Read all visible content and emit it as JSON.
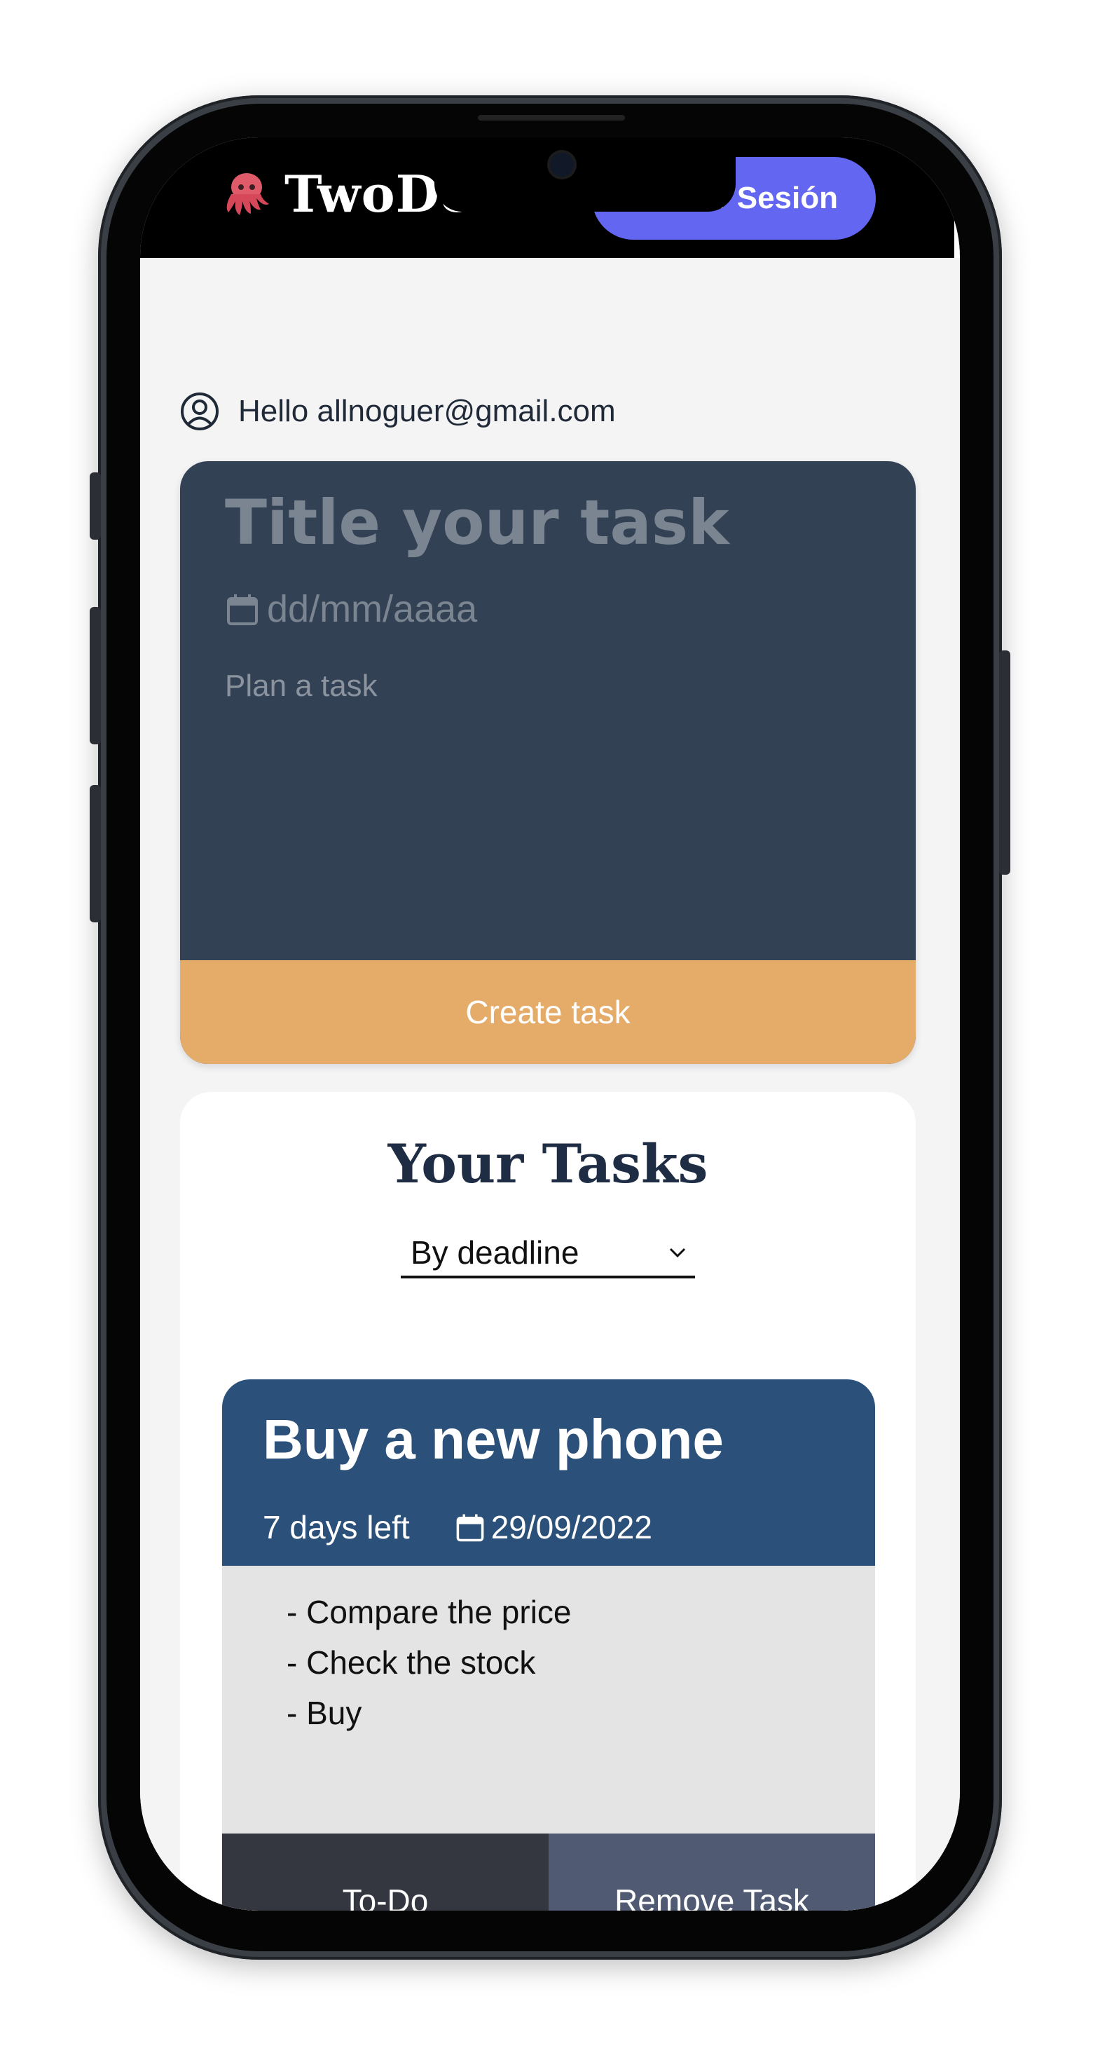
{
  "header": {
    "logo_text": "TwoDo",
    "logout_label": "ar Sesión"
  },
  "user": {
    "greeting": "Hello allnoguer@gmail.com"
  },
  "new_task": {
    "title_placeholder": "Title your task",
    "date_placeholder": "dd/mm/aaaa",
    "description_placeholder": "Plan a task",
    "create_label": "Create task"
  },
  "tasks": {
    "heading": "Your Tasks",
    "sort_value": "By deadline",
    "items": [
      {
        "title": "Buy a new phone",
        "days_left": "7 days left",
        "due_date": "29/09/2022",
        "lines": [
          "- Compare the price",
          "- Check the stock",
          "- Buy"
        ],
        "status_label": "To-Do",
        "remove_label": "Remove Task"
      }
    ]
  },
  "colors": {
    "accent": "#6366f1",
    "card_dark": "#334155",
    "create_button": "#e5ac69",
    "task_header": "#2b5079"
  }
}
